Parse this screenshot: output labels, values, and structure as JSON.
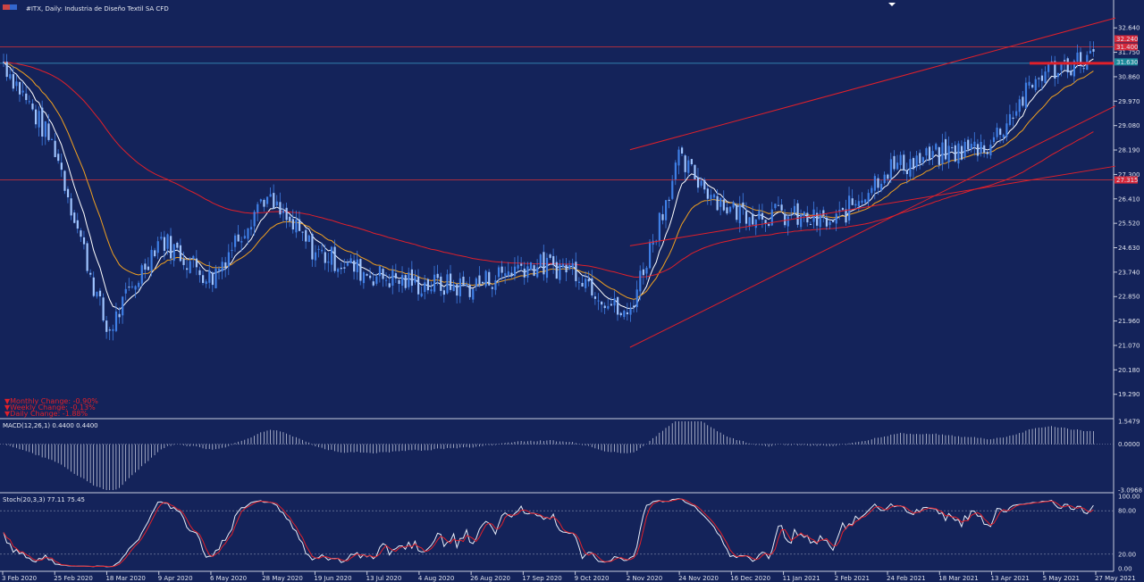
{
  "header": {
    "title": "#ITX, Daily:  Industria de Diseño Textil SA CFD"
  },
  "changes": [
    "▼Monthly Change: -0.90%",
    "▼Weekly Change: -0.13%",
    "▼Daily Change: -1.88%"
  ],
  "price_badges": [
    "32.240",
    "31.400",
    "31.630",
    "27.315"
  ],
  "colors": {
    "background": "#14235a",
    "candle": "#3f7fe6",
    "ma_fast": "#ffffff",
    "ma_mid": "#f0a020",
    "ma_slow": "#e0202a",
    "trendline": "#e0202a",
    "macd_hist": "#d8dcec",
    "stoch_main": "#e8edf8",
    "stoch_signal": "#e0202a",
    "panel_border": "#c8cdde"
  },
  "chart_data": [
    {
      "type": "candlestick",
      "ylim": [
        18.5,
        33.2
      ],
      "yticks": [
        32.64,
        31.75,
        30.86,
        29.97,
        29.08,
        28.19,
        27.3,
        26.41,
        25.52,
        24.63,
        23.74,
        22.85,
        21.96,
        21.07,
        20.18,
        19.29
      ],
      "x_labels": [
        "3 Feb 2020",
        "25 Feb 2020",
        "18 Mar 2020",
        "9 Apr 2020",
        "6 May 2020",
        "28 May 2020",
        "19 Jun 2020",
        "13 Jul 2020",
        "4 Aug 2020",
        "26 Aug 2020",
        "17 Sep 2020",
        "9 Oct 2020",
        "2 Nov 2020",
        "24 Nov 2020",
        "16 Dec 2020",
        "11 Jan 2021",
        "2 Feb 2021",
        "24 Feb 2021",
        "18 Mar 2021",
        "13 Apr 2021",
        "5 May 2021",
        "27 May 2021"
      ],
      "close_path": [
        [
          "3 Feb 2020",
          31.4
        ],
        [
          "25 Feb 2020",
          28.2
        ],
        [
          "18 Mar 2020",
          21.5
        ],
        [
          "9 Apr 2020",
          25.0
        ],
        [
          "6 May 2020",
          23.5
        ],
        [
          "28 May 2020",
          26.5
        ],
        [
          "19 Jun 2020",
          24.5
        ],
        [
          "13 Jul 2020",
          23.7
        ],
        [
          "4 Aug 2020",
          23.3
        ],
        [
          "26 Aug 2020",
          23.2
        ],
        [
          "17 Sep 2020",
          24.0
        ],
        [
          "9 Oct 2020",
          23.9
        ],
        [
          "2 Nov 2020",
          22.0
        ],
        [
          "24 Nov 2020",
          27.8
        ],
        [
          "16 Dec 2020",
          26.0
        ],
        [
          "11 Jan 2021",
          25.8
        ],
        [
          "2 Feb 2021",
          25.5
        ],
        [
          "24 Feb 2021",
          27.5
        ],
        [
          "18 Mar 2021",
          28.0
        ],
        [
          "13 Apr 2021",
          28.4
        ],
        [
          "5 May 2021",
          31.0
        ],
        [
          "27 May 2021",
          31.6
        ]
      ],
      "horizontal_levels": [
        31.95,
        31.35,
        27.1
      ],
      "trendlines": [
        [
          [
            "2 Nov 2020",
            28.2
          ],
          [
            "27 May 2021",
            33.0
          ]
        ],
        [
          [
            "2 Nov 2020",
            21.0
          ],
          [
            "27 May 2021",
            29.8
          ]
        ],
        [
          [
            "2 Nov 2020",
            24.7
          ],
          [
            "27 May 2021",
            27.6
          ]
        ]
      ]
    },
    {
      "type": "bar",
      "title": "MACD(12,26,1) 0.4400 0.4400",
      "ylim": [
        -3.0968,
        1.5479
      ],
      "yticks": [
        1.5479,
        0.0,
        -3.0968
      ]
    },
    {
      "type": "line",
      "title": "Stoch(20,3,3) 77.11 75.45",
      "ylim": [
        0,
        100
      ],
      "yticks": [
        100.0,
        80.0,
        20.0,
        0.0
      ],
      "levels": [
        80,
        20
      ]
    }
  ]
}
